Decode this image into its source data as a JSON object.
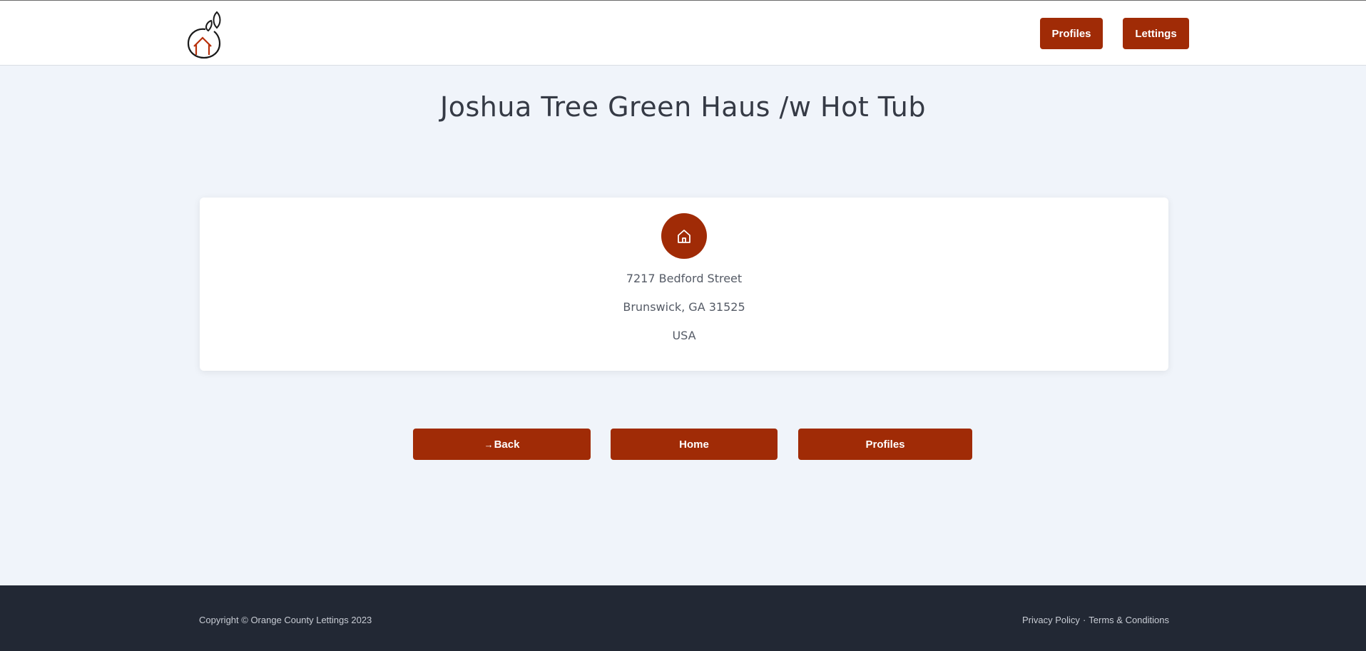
{
  "header": {
    "logo_icon": "orange-house-logo-icon",
    "nav": {
      "profiles_label": "Profiles",
      "lettings_label": "Lettings"
    }
  },
  "page": {
    "title": "Joshua Tree Green Haus /w Hot Tub"
  },
  "card": {
    "icon": "house-icon",
    "address": {
      "line1": "7217 Bedford Street",
      "line2": "Brunswick, GA 31525",
      "line3": "USA"
    }
  },
  "actions": {
    "back_icon": "→",
    "back_label": "Back",
    "home_label": "Home",
    "profiles_label": "Profiles"
  },
  "footer": {
    "copyright": "Copyright © Orange County Lettings 2023",
    "privacy_label": "Privacy Policy",
    "separator": "·",
    "terms_label": "Terms & Conditions"
  },
  "colors": {
    "accent": "#a02b06",
    "background": "#f0f4fa",
    "footer_bg": "#222834"
  }
}
